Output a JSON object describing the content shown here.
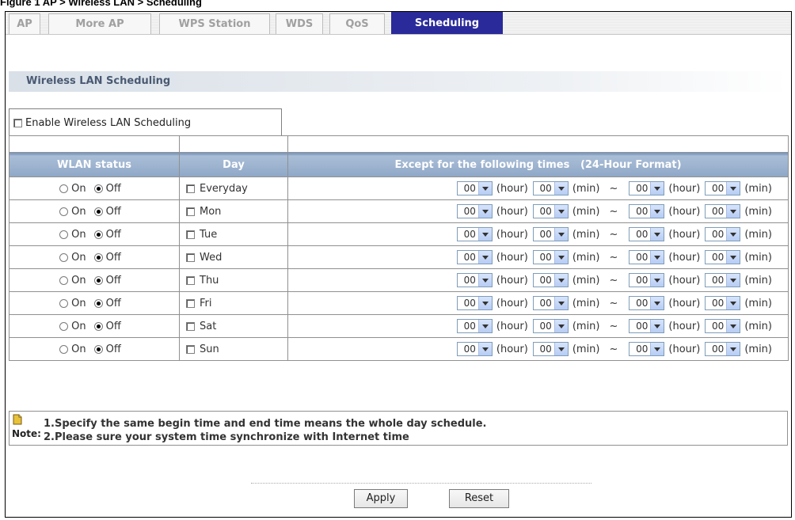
{
  "figure_caption": "Figure 1 AP > Wireless LAN > Scheduling",
  "tabs": [
    {
      "label": "AP",
      "active": false
    },
    {
      "label": "More AP",
      "active": false
    },
    {
      "label": "WPS Station",
      "active": false
    },
    {
      "label": "WDS",
      "active": false
    },
    {
      "label": "QoS",
      "active": false
    },
    {
      "label": "Scheduling",
      "active": true
    }
  ],
  "section_title": "Wireless LAN Scheduling",
  "enable_label": "Enable Wireless LAN Scheduling",
  "enable_checked": false,
  "table": {
    "headers": [
      "WLAN status",
      "Day",
      "Except for the following times   (24-Hour Format)"
    ],
    "on_label": "On",
    "off_label": "Off",
    "hour_unit": "(hour)",
    "min_unit": "(min)",
    "tilde": "~",
    "rows": [
      {
        "day": "Everyday",
        "status": "Off",
        "day_checked": false,
        "start_hour": "00",
        "start_min": "00",
        "end_hour": "00",
        "end_min": "00"
      },
      {
        "day": "Mon",
        "status": "Off",
        "day_checked": false,
        "start_hour": "00",
        "start_min": "00",
        "end_hour": "00",
        "end_min": "00"
      },
      {
        "day": "Tue",
        "status": "Off",
        "day_checked": false,
        "start_hour": "00",
        "start_min": "00",
        "end_hour": "00",
        "end_min": "00"
      },
      {
        "day": "Wed",
        "status": "Off",
        "day_checked": false,
        "start_hour": "00",
        "start_min": "00",
        "end_hour": "00",
        "end_min": "00"
      },
      {
        "day": "Thu",
        "status": "Off",
        "day_checked": false,
        "start_hour": "00",
        "start_min": "00",
        "end_hour": "00",
        "end_min": "00"
      },
      {
        "day": "Fri",
        "status": "Off",
        "day_checked": false,
        "start_hour": "00",
        "start_min": "00",
        "end_hour": "00",
        "end_min": "00"
      },
      {
        "day": "Sat",
        "status": "Off",
        "day_checked": false,
        "start_hour": "00",
        "start_min": "00",
        "end_hour": "00",
        "end_min": "00"
      },
      {
        "day": "Sun",
        "status": "Off",
        "day_checked": false,
        "start_hour": "00",
        "start_min": "00",
        "end_hour": "00",
        "end_min": "00"
      }
    ]
  },
  "note": {
    "label": "Note:",
    "lines": [
      "1.Specify the same begin time and end time means the whole day schedule.",
      "2.Please sure your system time synchronize with Internet time"
    ]
  },
  "buttons": {
    "apply": "Apply",
    "reset": "Reset"
  },
  "colors": {
    "active_tab": "#2a2a9a",
    "header_bg": "#9db3cf",
    "section_text": "#4a5a73"
  }
}
